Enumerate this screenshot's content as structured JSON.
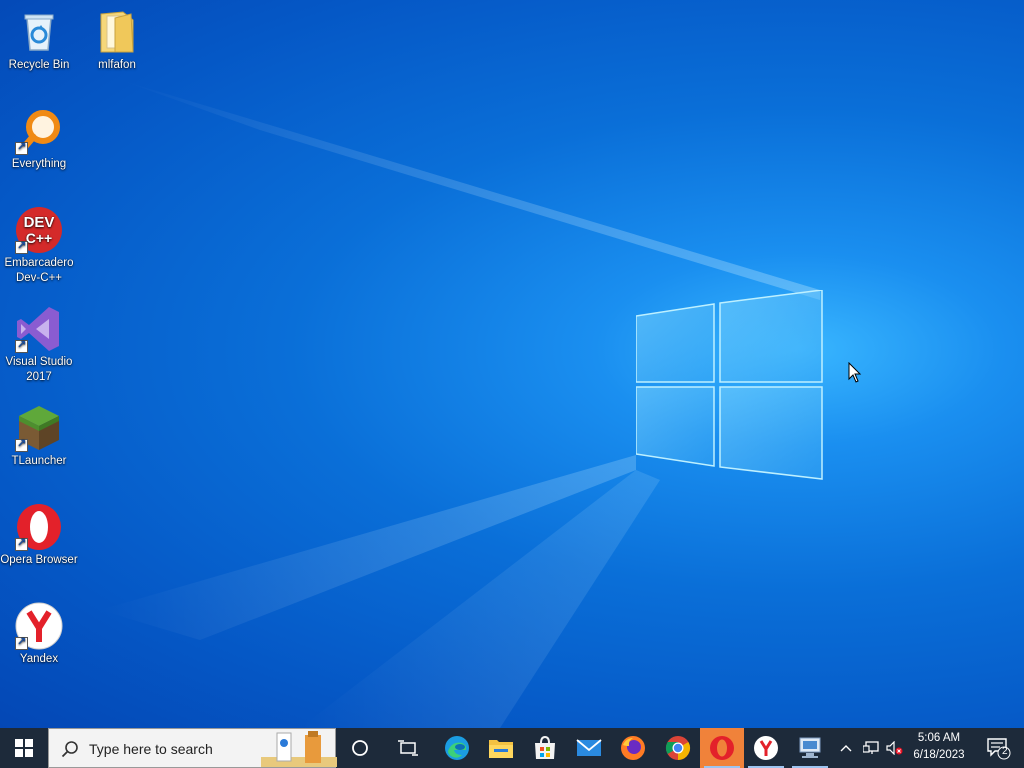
{
  "desktop": {
    "icons": [
      {
        "label": "Recycle Bin",
        "icon": "recycle-bin-icon"
      },
      {
        "label": "mlfafon",
        "icon": "folder-icon"
      },
      {
        "label": "Everything",
        "icon": "everything-icon"
      },
      {
        "label": "Embarcadero Dev-C++",
        "icon": "devcpp-icon",
        "icon_text": "DEV C++"
      },
      {
        "label": "Visual Studio 2017",
        "icon": "visual-studio-icon"
      },
      {
        "label": "TLauncher",
        "icon": "tlauncher-icon"
      },
      {
        "label": "Opera Browser",
        "icon": "opera-icon"
      },
      {
        "label": "Yandex",
        "icon": "yandex-icon"
      }
    ]
  },
  "taskbar": {
    "start_icon": "windows-start-icon",
    "search_placeholder": "Type here to search",
    "pinned": [
      "cortana-icon",
      "task-view-icon",
      "edge-icon",
      "file-explorer-icon",
      "microsoft-store-icon",
      "mail-icon",
      "firefox-icon",
      "chrome-icon",
      "opera-icon",
      "yandex-icon",
      "remote-desktop-icon"
    ],
    "active_app": "opera-icon",
    "tray": {
      "icons": [
        "chevron-up-icon",
        "network-icon",
        "volume-muted-icon"
      ],
      "time": "5:06 AM",
      "date": "6/18/2023",
      "notifications_count": "2"
    }
  },
  "colors": {
    "taskbar_bg": "#1d2a3a",
    "desktop_blue": "#0a6fd8",
    "opera_red": "#e3212a"
  }
}
